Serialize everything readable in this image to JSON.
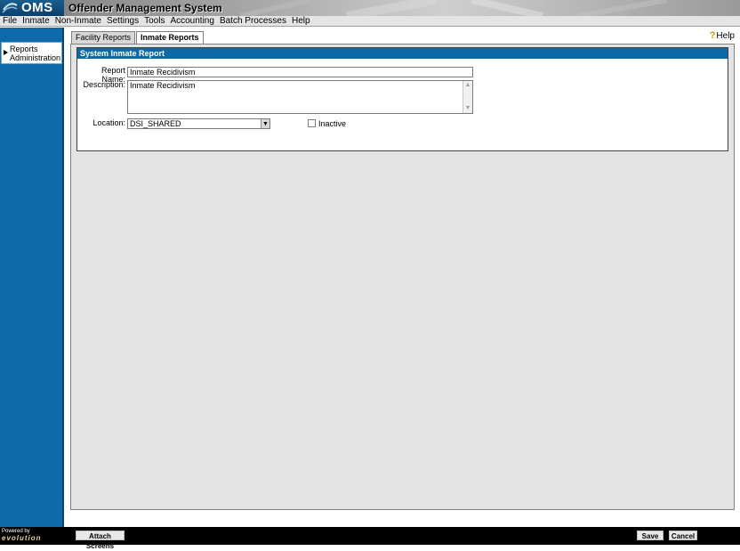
{
  "app": {
    "logo_text": "OMS",
    "title": "Offender Management System"
  },
  "menu": [
    "File",
    "Inmate",
    "Non-Inmate",
    "Settings",
    "Tools",
    "Accounting",
    "Batch Processes",
    "Help"
  ],
  "sidebar": {
    "items": [
      {
        "label_line1": "Reports",
        "label_line2": "Administration"
      }
    ]
  },
  "help": {
    "label": "Help"
  },
  "tabs": [
    {
      "label": "Facility Reports",
      "active": false
    },
    {
      "label": "Inmate Reports",
      "active": true
    }
  ],
  "report": {
    "header": "System Inmate Report",
    "name_label": "Report Name:",
    "name_value": "Inmate Recidivism",
    "description_label": "Description:",
    "description_value": "Inmate Recidivism",
    "location_label": "Location:",
    "location_value": "DSI_SHARED",
    "inactive_label": "Inactive",
    "inactive_checked": false
  },
  "footer": {
    "powered_by": "Powered by",
    "brand": "evolution",
    "attach_label": "Attach Screens",
    "save_label": "Save",
    "cancel_label": "Cancel"
  }
}
